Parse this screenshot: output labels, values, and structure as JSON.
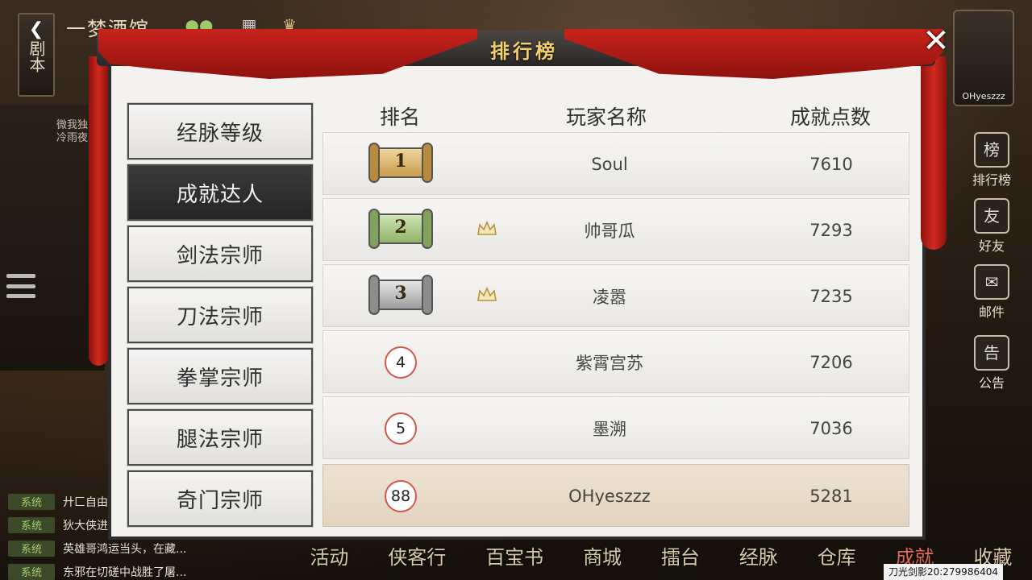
{
  "header": {
    "back_label": "剧本",
    "location": "一梦酒馆",
    "panel_title": "排行榜",
    "close_label": "✕"
  },
  "background": {
    "char_note": "微我独\n冷雨夜",
    "player_name": "OHyeszzz"
  },
  "right_menu": [
    {
      "label": "排行榜",
      "icon": "ranking-icon",
      "glyph": "榜"
    },
    {
      "label": "好友",
      "icon": "friends-icon",
      "glyph": "友"
    },
    {
      "label": "邮件",
      "icon": "mail-icon",
      "glyph": "✉"
    },
    {
      "label": "公告",
      "icon": "announcement-icon",
      "glyph": "告"
    }
  ],
  "categories": [
    {
      "label": "经脉等级",
      "active": false
    },
    {
      "label": "成就达人",
      "active": true
    },
    {
      "label": "剑法宗师",
      "active": false
    },
    {
      "label": "刀法宗师",
      "active": false
    },
    {
      "label": "拳掌宗师",
      "active": false
    },
    {
      "label": "腿法宗师",
      "active": false
    },
    {
      "label": "奇门宗师",
      "active": false
    }
  ],
  "table": {
    "columns": [
      "排名",
      "玩家名称",
      "成就点数"
    ],
    "rows": [
      {
        "rank": "1",
        "name": "Soul",
        "score": "7610",
        "badge": "gold-scroll",
        "crown": false
      },
      {
        "rank": "2",
        "name": "帅哥瓜",
        "score": "7293",
        "badge": "green-scroll",
        "crown": true
      },
      {
        "rank": "3",
        "name": "凌嚣",
        "score": "7235",
        "badge": "silver-scroll",
        "crown": true
      },
      {
        "rank": "4",
        "name": "紫霄宫苏",
        "score": "7206",
        "badge": "circle",
        "crown": false
      },
      {
        "rank": "5",
        "name": "墨溯",
        "score": "7036",
        "badge": "circle",
        "crown": false
      },
      {
        "rank": "88",
        "name": "OHyeszzz",
        "score": "5281",
        "badge": "circle",
        "crown": false,
        "self": true
      }
    ]
  },
  "chat": [
    {
      "tag": "系统",
      "text": "廾匚自由"
    },
    {
      "tag": "系统",
      "text": "狄大侠进"
    },
    {
      "tag": "系统",
      "text": "英雄哥鸿运当头，在藏..."
    },
    {
      "tag": "系统",
      "text": "东邪在切磋中战胜了屠..."
    }
  ],
  "bottom_nav": [
    {
      "label": "活动",
      "active": false
    },
    {
      "label": "侠客行",
      "active": false
    },
    {
      "label": "百宝书",
      "active": false
    },
    {
      "label": "商城",
      "active": false
    },
    {
      "label": "擂台",
      "active": false
    },
    {
      "label": "经脉",
      "active": false
    },
    {
      "label": "仓库",
      "active": false
    },
    {
      "label": "成就",
      "active": true
    },
    {
      "label": "收藏",
      "active": false
    }
  ],
  "footer_info": "刀光剑影20:279986404",
  "colors": {
    "gold_scroll": "#d9b56a",
    "green_scroll": "#a9c98a",
    "silver_scroll": "#b9b9b9",
    "curtain_red": "#c8231c",
    "title_gold": "#f2d16b",
    "circle_border": "#d0584a"
  }
}
